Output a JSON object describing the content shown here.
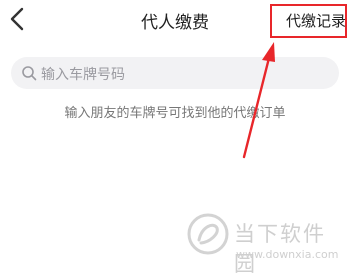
{
  "navbar": {
    "back_icon": "chevron-left-icon",
    "title": "代人缴费",
    "right_link": "代缴记录"
  },
  "search": {
    "icon": "search-icon",
    "placeholder": "输入车牌号码"
  },
  "hint": "输入朋友的车牌号可找到他的代缴订单",
  "annotation": {
    "color": "#e8262a",
    "target": "代缴记录"
  },
  "watermark": {
    "logo_icon": "downxia-logo-icon",
    "name": "当下软件园",
    "url": "www.downxia.com"
  }
}
